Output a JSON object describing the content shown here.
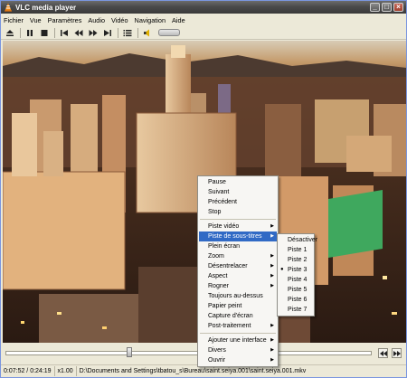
{
  "window": {
    "title": "VLC media player"
  },
  "menubar": [
    "Fichier",
    "Vue",
    "Paramètres",
    "Audio",
    "Vidéo",
    "Navigation",
    "Aide"
  ],
  "toolbar": {
    "buttons": [
      "eject-icon",
      "pause-icon",
      "stop-icon",
      "previous-icon",
      "rewind-icon",
      "forward-icon",
      "next-icon",
      "playlist-icon",
      "volume-icon"
    ]
  },
  "player": {
    "seek_position": 0.33
  },
  "status": {
    "time": "0:07:52 / 0:24:19",
    "speed": "x1.00",
    "path": "D:\\Documents and Settings\\tbatou_s\\Bureau\\saint.seiya.001\\saint.seiya.001.mkv"
  },
  "context_menu": {
    "group1": [
      "Pause",
      "Suivant",
      "Précédent",
      "Stop"
    ],
    "group2": [
      "Piste vidéo",
      "Piste de sous-titres",
      "Plein écran",
      "Zoom",
      "Désentrelacer",
      "Aspect",
      "Rogner",
      "Toujours au-dessus",
      "Papier peint",
      "Capture d'écran",
      "Post-traitement"
    ],
    "group3": [
      "Ajouter une interface",
      "Divers",
      "Ouvrir"
    ]
  },
  "submenu": {
    "items": [
      "Désactiver",
      "Piste 1",
      "Piste 2",
      "Piste 3",
      "Piste 4",
      "Piste 5",
      "Piste 6",
      "Piste 7"
    ],
    "selected_index": 3
  }
}
